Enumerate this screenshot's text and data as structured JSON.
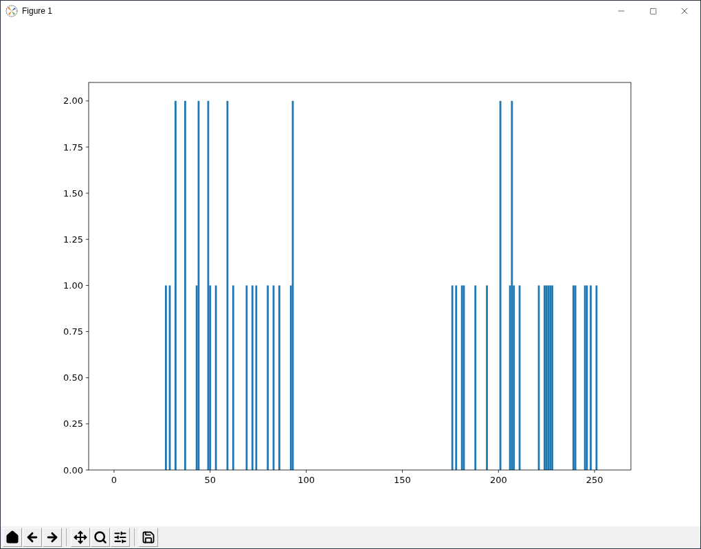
{
  "window": {
    "title": "Figure 1"
  },
  "figure": {
    "chart_data": {
      "type": "bar",
      "x": [
        27,
        29,
        32,
        37,
        43,
        44,
        49,
        50,
        53,
        59,
        62,
        69,
        72,
        74,
        80,
        83,
        86,
        92,
        93,
        176,
        178,
        181,
        182,
        188,
        194,
        201,
        206,
        207,
        208,
        211,
        221,
        224,
        225,
        226,
        227,
        228,
        239,
        240,
        245,
        246,
        248,
        251
      ],
      "values": [
        1,
        1,
        2,
        2,
        1,
        2,
        2,
        1,
        1,
        2,
        1,
        1,
        1,
        1,
        1,
        1,
        1,
        1,
        2,
        1,
        1,
        1,
        1,
        1,
        1,
        2,
        1,
        2,
        1,
        1,
        1,
        1,
        1,
        1,
        1,
        1,
        1,
        1,
        1,
        1,
        1,
        1
      ],
      "xlim": [
        -13.2,
        268.9
      ],
      "ylim": [
        0,
        2.1
      ],
      "xticks": [
        0,
        50,
        100,
        150,
        200,
        250
      ],
      "yticks": [
        {
          "value": 0,
          "label": "0.00"
        },
        {
          "value": 0.25,
          "label": "0.25"
        },
        {
          "value": 0.5,
          "label": "0.50"
        },
        {
          "value": 0.75,
          "label": "0.75"
        },
        {
          "value": 1,
          "label": "1.00"
        },
        {
          "value": 1.25,
          "label": "1.25"
        },
        {
          "value": 1.5,
          "label": "1.50"
        },
        {
          "value": 1.75,
          "label": "1.75"
        },
        {
          "value": 2,
          "label": "2.00"
        }
      ]
    }
  }
}
